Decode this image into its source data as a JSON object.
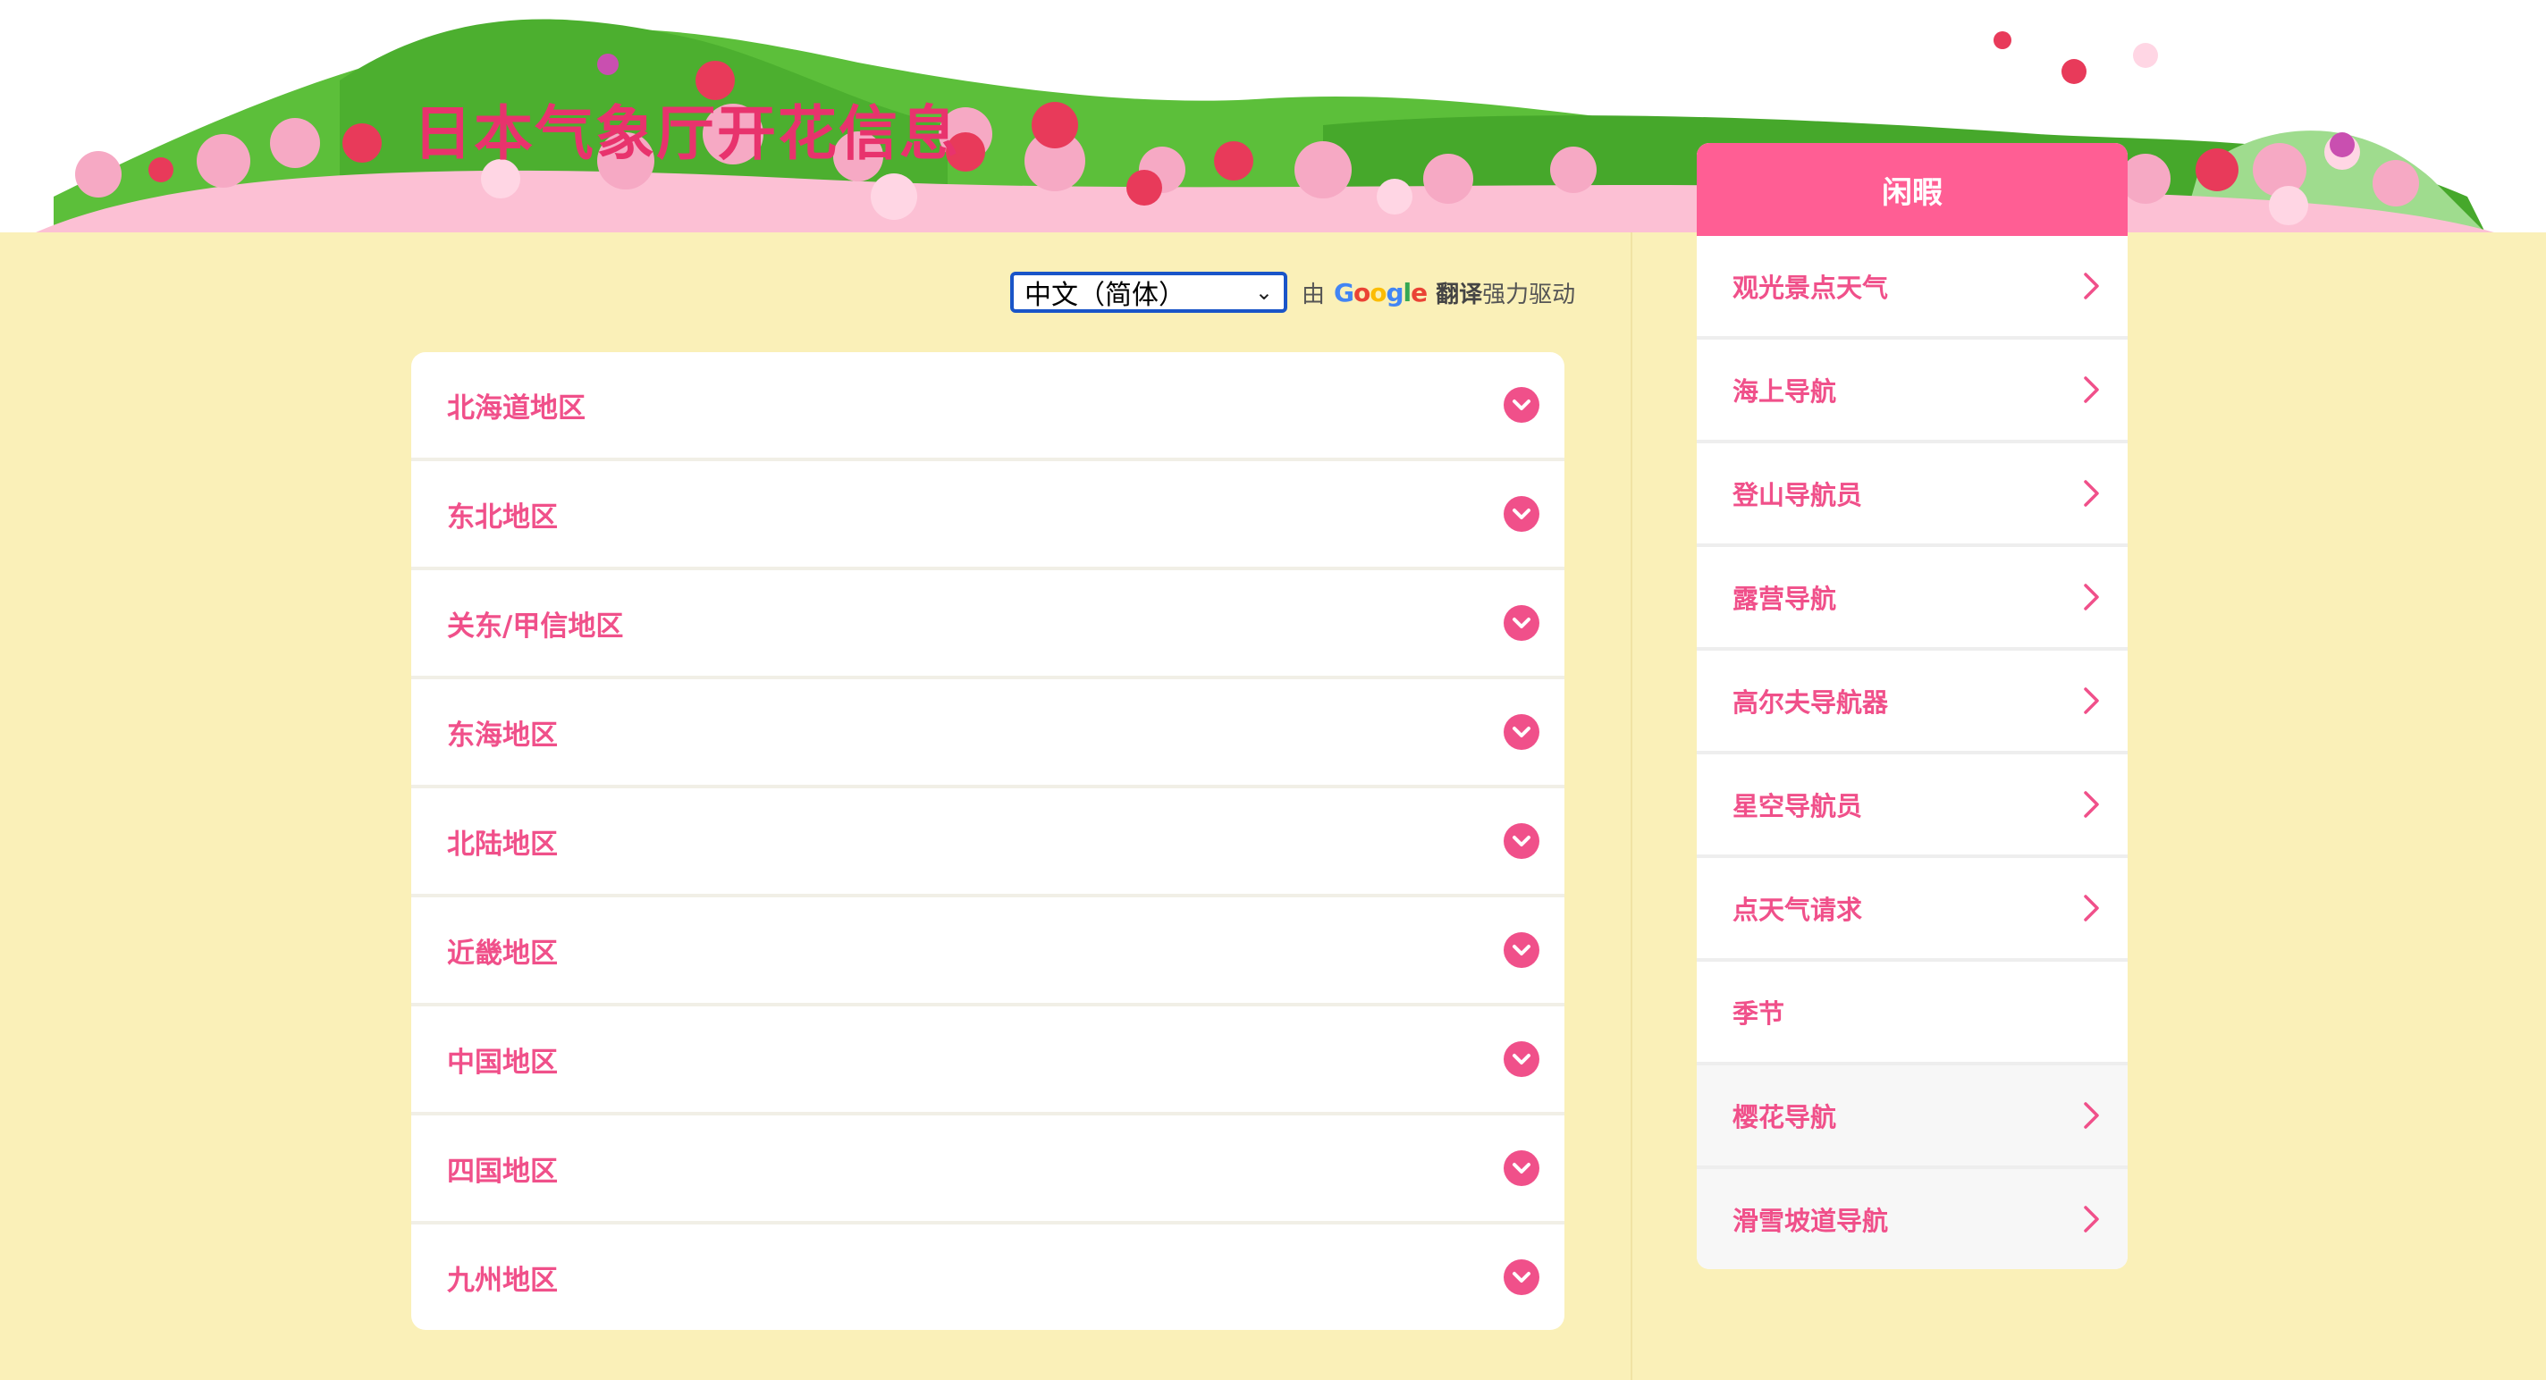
{
  "header": {
    "title": "日本气象厅开花信息"
  },
  "translate": {
    "selected_language": "中文（简体）",
    "powered_prefix": "由",
    "google_letters": [
      "G",
      "o",
      "o",
      "g",
      "l",
      "e"
    ],
    "translate_word": "翻译",
    "powered_suffix": "强力驱动"
  },
  "regions": [
    {
      "label": "北海道地区"
    },
    {
      "label": "东北地区"
    },
    {
      "label": "关东/甲信地区"
    },
    {
      "label": "东海地区"
    },
    {
      "label": "北陆地区"
    },
    {
      "label": "近畿地区"
    },
    {
      "label": "中国地区"
    },
    {
      "label": "四国地区"
    },
    {
      "label": "九州地区"
    }
  ],
  "sidebar": {
    "title": "闲暇",
    "items": [
      {
        "label": "观光景点天气",
        "has_arrow": true
      },
      {
        "label": "海上导航",
        "has_arrow": true
      },
      {
        "label": "登山导航员",
        "has_arrow": true
      },
      {
        "label": "露营导航",
        "has_arrow": true
      },
      {
        "label": "高尔夫导航器",
        "has_arrow": true
      },
      {
        "label": "星空导航员",
        "has_arrow": true
      },
      {
        "label": "点天气请求",
        "has_arrow": true
      },
      {
        "label": "季节",
        "has_arrow": false
      },
      {
        "label": "樱花导航",
        "has_arrow": true
      },
      {
        "label": "滑雪坡道导航",
        "has_arrow": true
      }
    ]
  },
  "colors": {
    "accent_pink": "#f0508a",
    "header_pink": "#ff5e94",
    "title_color": "#e8336d",
    "page_background": "#faf0b8",
    "hill_green": "#4caf2f"
  },
  "icons": {
    "region_expand": "chevron-down-circle-icon",
    "sidebar_arrow": "chevron-right-icon"
  }
}
